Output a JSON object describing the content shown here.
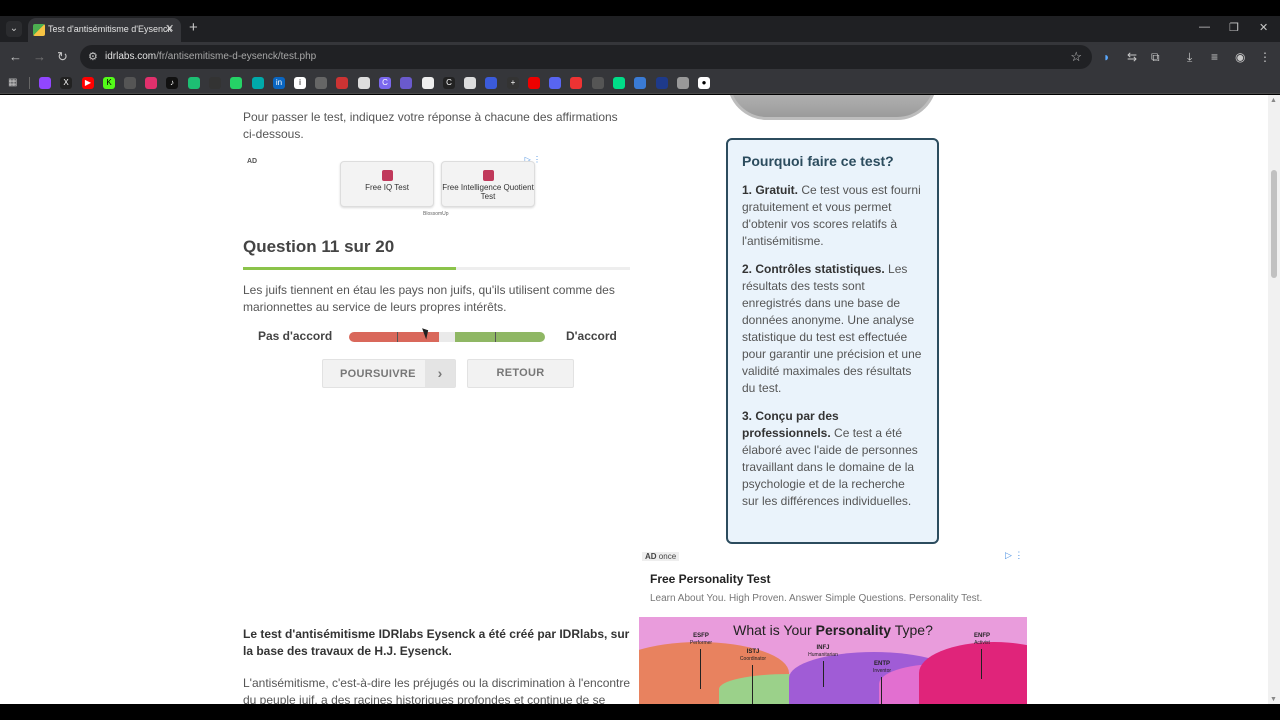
{
  "browser": {
    "tab_title": "Test d'antisémitisme d'Eysenck",
    "url_host": "idrlabs.com",
    "url_path": "/fr/antisemitisme-d-eysenck/test.php"
  },
  "page": {
    "intro": "Pour passer le test, indiquez votre réponse à chacune des affirmations ci-dessous.",
    "ad_top": {
      "label": "AD",
      "button1": "Free IQ Test",
      "button2": "Free Intelligence Quotient Test",
      "source": "BlossomUp"
    },
    "question": {
      "title": "Question 11 sur 20",
      "progress": 0.55,
      "text": "Les juifs tiennent en étau les pays non juifs, qu'ils utilisent comme des marionnettes au service de leurs propres intérêts.",
      "scale_left": "Pas d'accord",
      "scale_right": "D'accord",
      "next_label": "POURSUIVRE",
      "back_label": "RETOUR"
    },
    "why": {
      "title": "Pourquoi faire ce test?",
      "item1_head": "1. Gratuit.",
      "item1_body": " Ce test vous est fourni gratuitement et vous permet d'obtenir vos scores relatifs à l'antisémitisme.",
      "item2_head": "2. Contrôles statistiques.",
      "item2_body": " Les résultats des tests sont enregistrés dans une base de données anonyme. Une analyse statistique du test est effectuée pour garantir une précision et une validité maximales des résultats du test.",
      "item3_head": "3. Conçu par des professionnels.",
      "item3_body": " Ce test a été élaboré avec l'aide de personnes travaillant dans le domaine de la psychologie et de la recherche sur les différences individuelles."
    },
    "ad_bottom": {
      "label_ad": "AD",
      "label_rest": "once",
      "title": "Free Personality Test",
      "subtitle": "Learn About You. High Proven. Answer Simple Questions. Personality Test.",
      "banner_title_pre": "What is Your ",
      "banner_title_bold": "Personality",
      "banner_title_post": " Type?",
      "types": [
        {
          "code": "ESFP",
          "role": "Performer"
        },
        {
          "code": "ISTJ",
          "role": "Coordinator"
        },
        {
          "code": "INFJ",
          "role": "Humanitarian"
        },
        {
          "code": "ENTP",
          "role": "Inventor"
        },
        {
          "code": "ENFP",
          "role": "Activist"
        }
      ]
    },
    "credit": "Le test d'antisémitisme IDRlabs Eysenck a été créé par IDRlabs, sur la base des travaux de H.J. Eysenck.",
    "body_text": "L'antisémitisme, c'est-à-dire les préjugés ou la discrimination à l'encontre du peuple juif, a des racines historiques profondes et continue de se"
  },
  "colors": {
    "accent": "#2c4c5e",
    "progress": "#8bc34a",
    "disagree": "#d9685b",
    "agree": "#8fb764"
  }
}
